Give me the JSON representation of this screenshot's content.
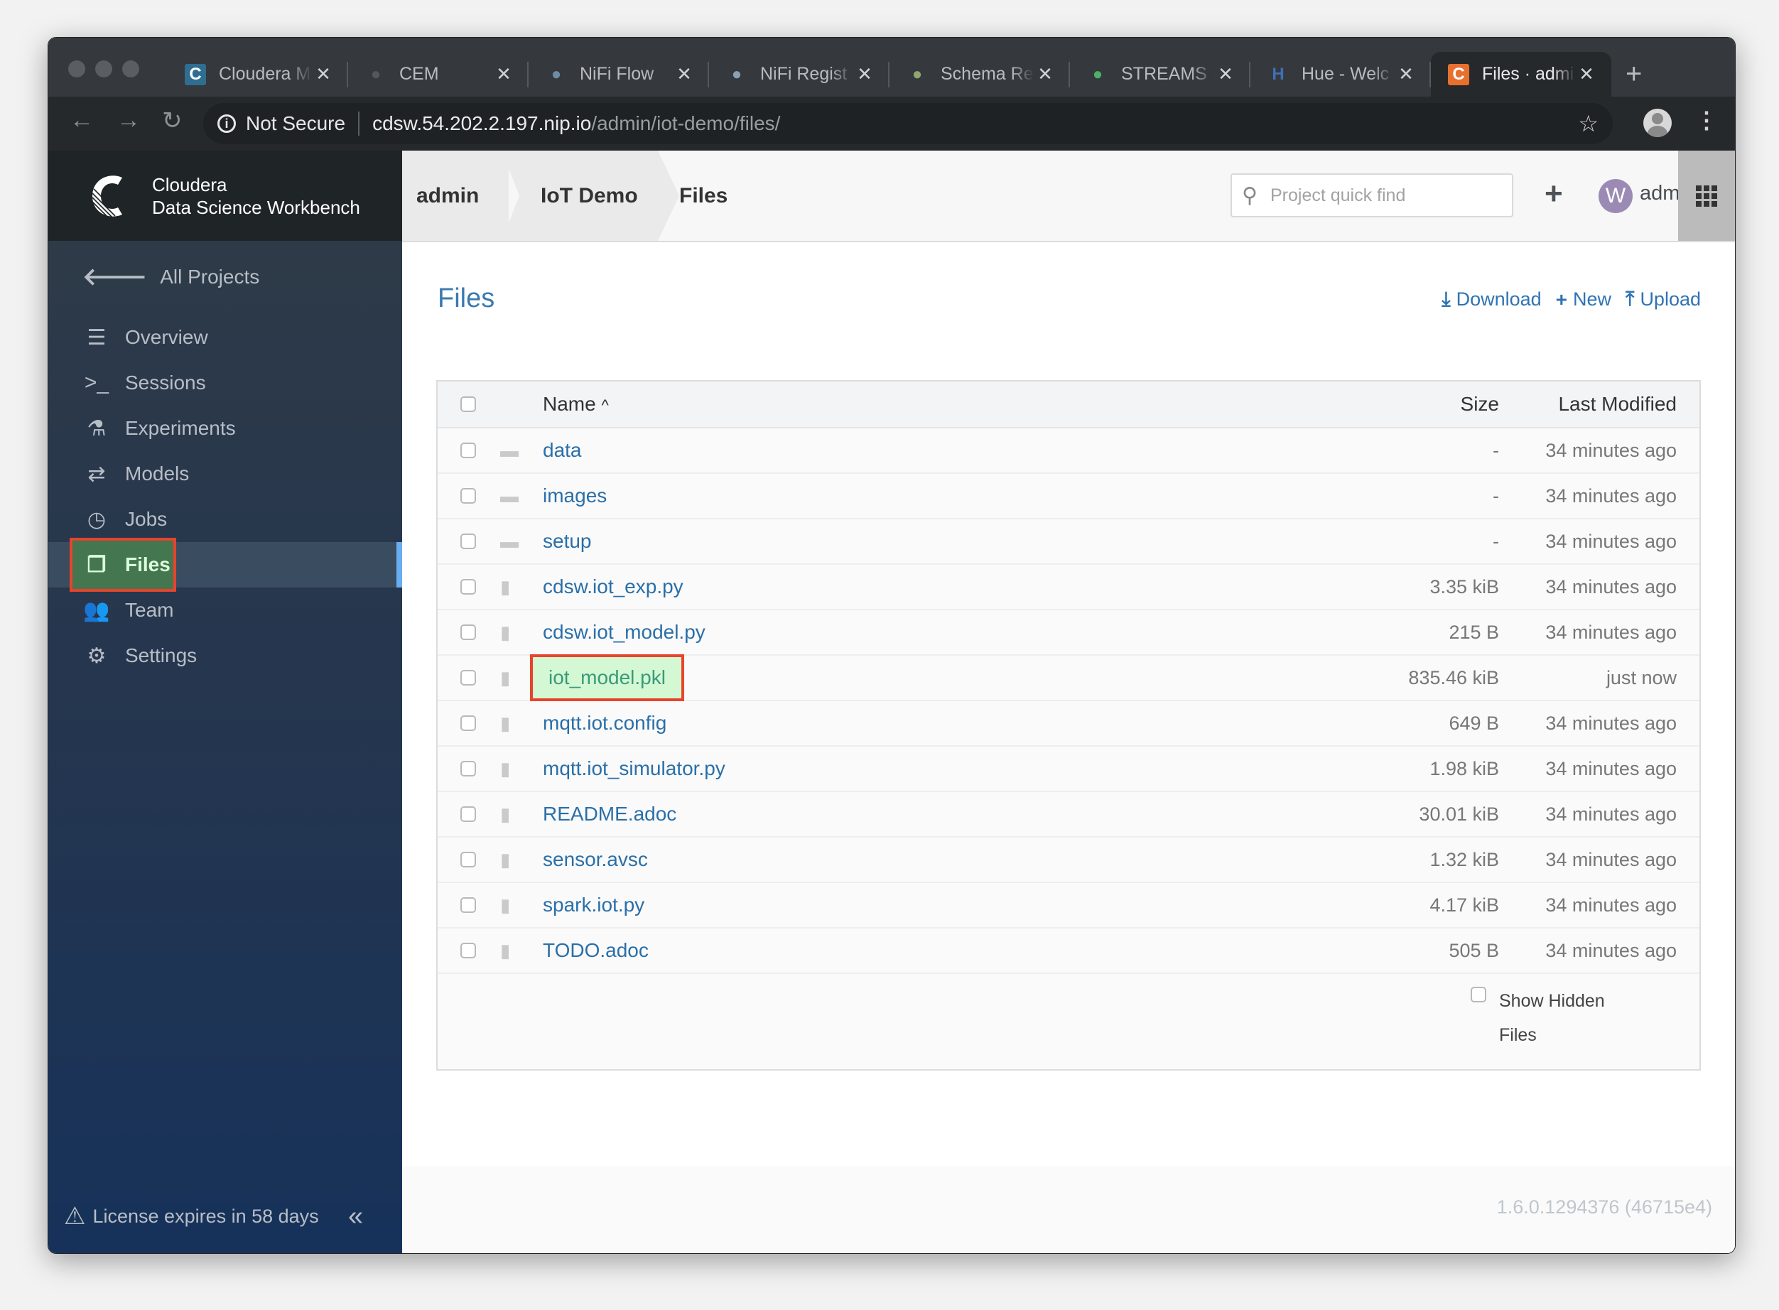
{
  "browser": {
    "tabs": [
      {
        "title": "Cloudera M",
        "icon": "cloudera-manager-icon",
        "icon_color": "#2f6e91",
        "active": false
      },
      {
        "title": "CEM",
        "icon": "cem-icon",
        "icon_color": "#55585b",
        "active": false
      },
      {
        "title": "NiFi Flow",
        "icon": "nifi-drop-icon",
        "icon_color": "#6e8ca3",
        "active": false
      },
      {
        "title": "NiFi Regist",
        "icon": "nifi-registry-icon",
        "icon_color": "#8aa0b4",
        "active": false
      },
      {
        "title": "Schema Re",
        "icon": "schema-registry-icon",
        "icon_color": "#8fa86a",
        "active": false
      },
      {
        "title": "STREAMS I",
        "icon": "streams-icon",
        "icon_color": "#4caf6a",
        "active": false
      },
      {
        "title": "Hue - Welc",
        "icon": "hue-icon",
        "icon_color": "#3f6fb5",
        "active": false
      },
      {
        "title": "Files · admi",
        "icon": "cdsw-icon",
        "icon_color": "#e8702f",
        "active": true
      }
    ],
    "new_tab": "+",
    "security_label": "Not Secure",
    "url_host": "cdsw.54.202.2.197.nip.io",
    "url_path": "/admin/iot-demo/files/"
  },
  "brand": {
    "line1": "Cloudera",
    "line2": "Data Science Workbench"
  },
  "breadcrumb": [
    "admin",
    "IoT Demo",
    "Files"
  ],
  "header": {
    "search_placeholder": "Project quick find",
    "add_label": "+",
    "avatar_initial": "W",
    "username": "admin"
  },
  "sidebar": {
    "back_label": "All Projects",
    "items": [
      {
        "label": "Overview",
        "icon": "overview-icon",
        "glyph": "☰"
      },
      {
        "label": "Sessions",
        "icon": "terminal-icon",
        "glyph": ">_"
      },
      {
        "label": "Experiments",
        "icon": "flask-icon",
        "glyph": "⚗"
      },
      {
        "label": "Models",
        "icon": "exchange-arrows-icon",
        "glyph": "⇄"
      },
      {
        "label": "Jobs",
        "icon": "clock-icon",
        "glyph": "◷"
      },
      {
        "label": "Files",
        "icon": "files-icon",
        "glyph": "❐",
        "active": true
      },
      {
        "label": "Team",
        "icon": "team-icon",
        "glyph": "👥"
      },
      {
        "label": "Settings",
        "icon": "gear-icon",
        "glyph": "⚙"
      }
    ],
    "license": "License expires in 58 days",
    "collapse": "«"
  },
  "main": {
    "title": "Files",
    "actions": [
      {
        "label": "Download",
        "icon": "download-icon",
        "glyph": "⤓"
      },
      {
        "label": "New",
        "icon": "plus-icon",
        "glyph": "+"
      },
      {
        "label": "Upload",
        "icon": "upload-icon",
        "glyph": "⤒"
      }
    ],
    "columns": {
      "name": "Name",
      "sort": "^",
      "size": "Size",
      "modified": "Last Modified"
    },
    "files": [
      {
        "name": "data",
        "type": "folder",
        "size": "-",
        "modified": "34 minutes ago"
      },
      {
        "name": "images",
        "type": "folder",
        "size": "-",
        "modified": "34 minutes ago"
      },
      {
        "name": "setup",
        "type": "folder",
        "size": "-",
        "modified": "34 minutes ago"
      },
      {
        "name": "cdsw.iot_exp.py",
        "type": "file",
        "size": "3.35 kiB",
        "modified": "34 minutes ago"
      },
      {
        "name": "cdsw.iot_model.py",
        "type": "file",
        "size": "215 B",
        "modified": "34 minutes ago"
      },
      {
        "name": "iot_model.pkl",
        "type": "file",
        "size": "835.46 kiB",
        "modified": "just now",
        "highlighted": true
      },
      {
        "name": "mqtt.iot.config",
        "type": "file",
        "size": "649 B",
        "modified": "34 minutes ago"
      },
      {
        "name": "mqtt.iot_simulator.py",
        "type": "file",
        "size": "1.98 kiB",
        "modified": "34 minutes ago"
      },
      {
        "name": "README.adoc",
        "type": "file",
        "size": "30.01 kiB",
        "modified": "34 minutes ago"
      },
      {
        "name": "sensor.avsc",
        "type": "file",
        "size": "1.32 kiB",
        "modified": "34 minutes ago"
      },
      {
        "name": "spark.iot.py",
        "type": "file",
        "size": "4.17 kiB",
        "modified": "34 minutes ago"
      },
      {
        "name": "TODO.adoc",
        "type": "file",
        "size": "505 B",
        "modified": "34 minutes ago"
      }
    ],
    "show_hidden_line1": "Show Hidden",
    "show_hidden_line2": "Files"
  },
  "footer": {
    "version": "1.6.0.1294376 (46715e4)"
  },
  "colors": {
    "accent": "#2f73b3",
    "highlight_border": "#e8432b",
    "highlight_fill": "#d4f8d4",
    "active_nav": "#447650"
  }
}
